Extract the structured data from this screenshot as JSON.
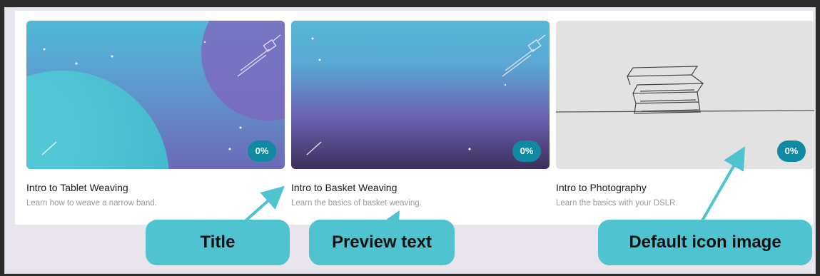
{
  "courses": [
    {
      "title": "Intro to Tablet Weaving",
      "preview": "Learn how to weave a narrow band.",
      "progress": "0%",
      "image": "space-planet-satellite"
    },
    {
      "title": "Intro to Basket Weaving",
      "preview": "Learn the basics of basket weaving.",
      "progress": "0%",
      "image": "space-aurora-satellite"
    },
    {
      "title": "Intro to Photography",
      "preview": "Learn the basics with your DSLR.",
      "progress": "0%",
      "image": "default-books-icon"
    }
  ],
  "annotations": {
    "title_label": "Title",
    "preview_label": "Preview text",
    "default_icon_label": "Default icon image"
  },
  "colors": {
    "badge": "#0f8aa2",
    "callout": "#4fc3d0",
    "arrow": "#4fc3d0"
  }
}
